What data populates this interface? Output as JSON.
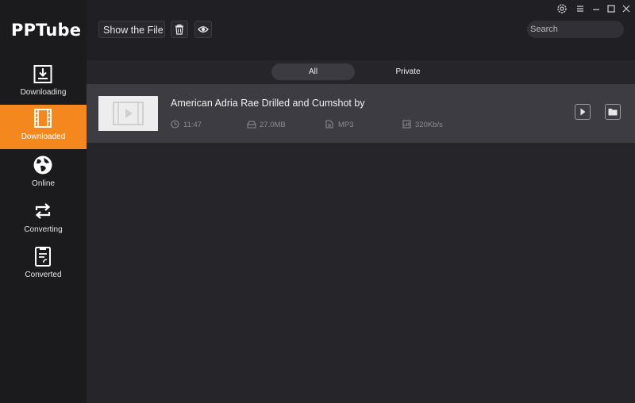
{
  "app": {
    "name": "PPTube"
  },
  "sidebar": {
    "items": [
      {
        "label": "Downloading",
        "icon": "download-icon"
      },
      {
        "label": "Downloaded",
        "icon": "film-icon",
        "active": true
      },
      {
        "label": "Online",
        "icon": "globe-icon"
      },
      {
        "label": "Converting",
        "icon": "convert-icon"
      },
      {
        "label": "Converted",
        "icon": "converted-file-icon"
      }
    ]
  },
  "toolbar": {
    "show_file_label": "Show the File",
    "delete_icon": "trash-icon",
    "preview_icon": "eye-icon"
  },
  "search": {
    "placeholder": "Search"
  },
  "window_controls": [
    "settings-icon",
    "menu-icon",
    "minimize-icon",
    "maximize-icon",
    "close-icon"
  ],
  "tabs": [
    {
      "label": "All",
      "active": true
    },
    {
      "label": "Private"
    }
  ],
  "items": [
    {
      "title": "American Adria Rae Drilled and Cumshot by",
      "duration": "11:47",
      "size": "27.0MB",
      "format": "MP3",
      "bitrate": "320Kb/s"
    }
  ],
  "colors": {
    "accent": "#f5871f",
    "sidebar_bg": "#1b1b1e",
    "main_bg": "#25252a",
    "row_bg": "#3c3c42"
  }
}
